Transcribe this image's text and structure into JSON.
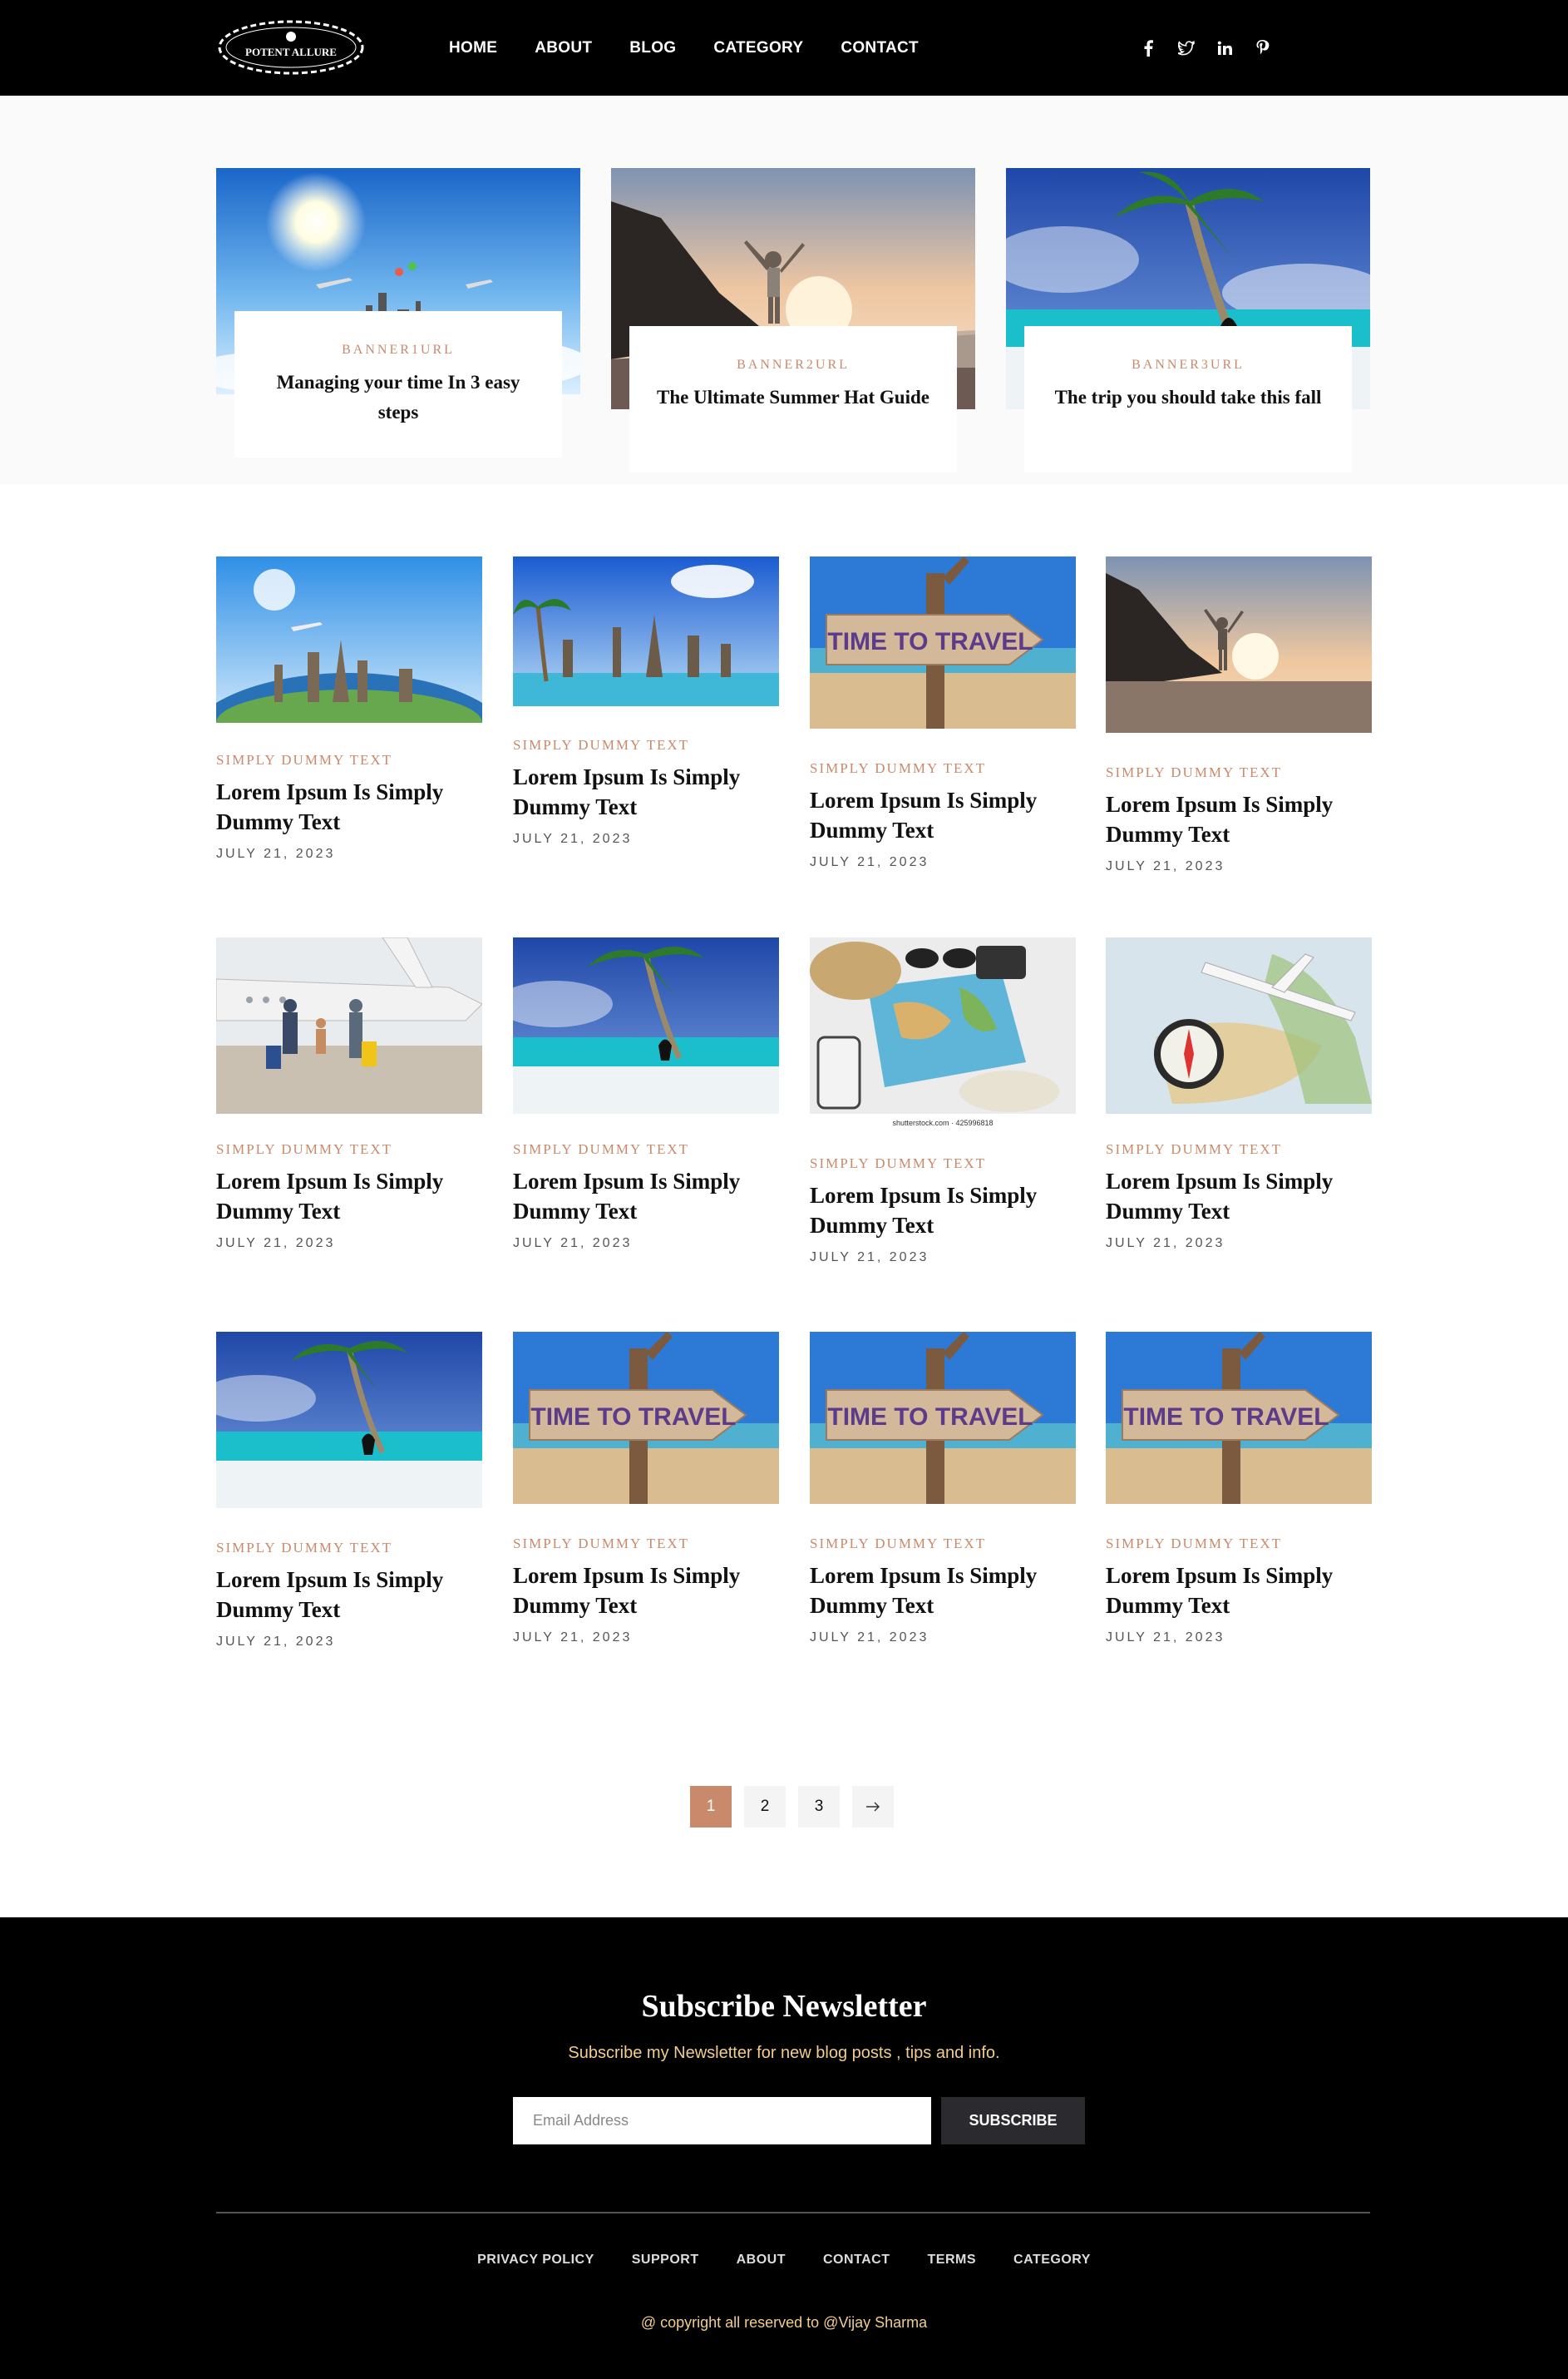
{
  "header": {
    "logo_text": "POTENT ALLURE",
    "nav": [
      "HOME",
      "ABOUT",
      "BLOG",
      "CATEGORY",
      "CONTACT"
    ],
    "social": [
      "facebook-icon",
      "twitter-icon",
      "linkedin-icon",
      "pinterest-icon"
    ]
  },
  "banners": [
    {
      "tag": "BANNER1URL",
      "title": "Managing your time In 3 easy steps",
      "image": "airplanes-landmarks-sky"
    },
    {
      "tag": "BANNER2URL",
      "title": "The Ultimate Summer Hat Guide",
      "image": "traveler-beach-sunset"
    },
    {
      "tag": "BANNER3URL",
      "title": "The trip you should take this fall",
      "image": "palm-tree-tropical-beach"
    }
  ],
  "posts": [
    {
      "category": "SIMPLY DUMMY TEXT",
      "title": "Lorem Ipsum Is Simply Dummy Text",
      "date": "JULY 21, 2023",
      "image": "globe-landmarks"
    },
    {
      "category": "SIMPLY DUMMY TEXT",
      "title": "Lorem Ipsum Is Simply Dummy Text",
      "date": "JULY 21, 2023",
      "image": "island-landmarks"
    },
    {
      "category": "SIMPLY DUMMY TEXT",
      "title": "Lorem Ipsum Is Simply Dummy Text",
      "date": "JULY 21, 2023",
      "image": "time-to-travel-sign",
      "sign_text": "TIME TO TRAVEL"
    },
    {
      "category": "SIMPLY DUMMY TEXT",
      "title": "Lorem Ipsum Is Simply Dummy Text",
      "date": "JULY 21, 2023",
      "image": "traveler-beach-sunset"
    },
    {
      "category": "SIMPLY DUMMY TEXT",
      "title": "Lorem Ipsum Is Simply Dummy Text",
      "date": "JULY 21, 2023",
      "image": "family-airport"
    },
    {
      "category": "SIMPLY DUMMY TEXT",
      "title": "Lorem Ipsum Is Simply Dummy Text",
      "date": "JULY 21, 2023",
      "image": "palm-tree-tropical-beach"
    },
    {
      "category": "SIMPLY DUMMY TEXT",
      "title": "Lorem Ipsum Is Simply Dummy Text",
      "date": "JULY 21, 2023",
      "image": "travel-accessories-map",
      "caption": "shutterstock.com · 425996818"
    },
    {
      "category": "SIMPLY DUMMY TEXT",
      "title": "Lorem Ipsum Is Simply Dummy Text",
      "date": "JULY 21, 2023",
      "image": "compass-map-airplane"
    },
    {
      "category": "SIMPLY DUMMY TEXT",
      "title": "Lorem Ipsum Is Simply Dummy Text",
      "date": "JULY 21, 2023",
      "image": "palm-tree-tropical-beach"
    },
    {
      "category": "SIMPLY DUMMY TEXT",
      "title": "Lorem Ipsum Is Simply Dummy Text",
      "date": "JULY 21, 2023",
      "image": "time-to-travel-sign",
      "sign_text": "TIME TO TRAVEL"
    },
    {
      "category": "SIMPLY DUMMY TEXT",
      "title": "Lorem Ipsum Is Simply Dummy Text",
      "date": "JULY 21, 2023",
      "image": "time-to-travel-sign",
      "sign_text": "TIME TO TRAVEL"
    },
    {
      "category": "SIMPLY DUMMY TEXT",
      "title": "Lorem Ipsum Is Simply Dummy Text",
      "date": "JULY 21, 2023",
      "image": "time-to-travel-sign",
      "sign_text": "TIME TO TRAVEL"
    }
  ],
  "pagination": {
    "pages": [
      "1",
      "2",
      "3"
    ],
    "current": "1",
    "next_icon": "arrow-right-icon"
  },
  "footer": {
    "title": "Subscribe Newsletter",
    "subtitle": "Subscribe my Newsletter for new blog posts , tips and info.",
    "email_placeholder": "Email Address",
    "subscribe_label": "SUBSCRIBE",
    "links": [
      "PRIVACY POLICY",
      "SUPPORT",
      "ABOUT",
      "CONTACT",
      "TERMS",
      "CATEGORY"
    ],
    "copyright": "@ copyright all reserved to @Vijay Sharma"
  },
  "colors": {
    "accent": "#c98a6b",
    "footer_accent": "#f2cd8e",
    "header_bg": "#000000"
  }
}
